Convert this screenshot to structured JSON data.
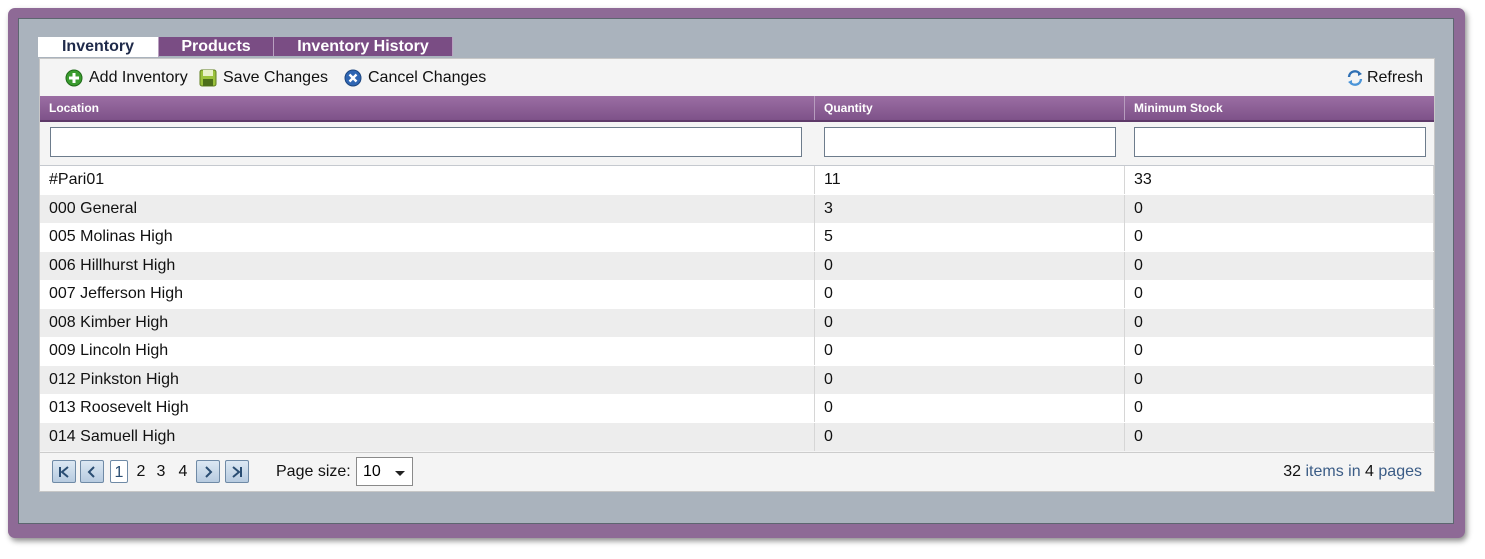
{
  "tabs": [
    {
      "label": "Inventory",
      "active": true
    },
    {
      "label": "Products",
      "active": false
    },
    {
      "label": "Inventory History",
      "active": false
    }
  ],
  "toolbar": {
    "add_label": "Add Inventory",
    "save_label": "Save Changes",
    "cancel_label": "Cancel Changes",
    "refresh_label": "Refresh"
  },
  "columns": [
    "Location",
    "Quantity",
    "Minimum Stock"
  ],
  "filters": {
    "location": "",
    "quantity": "",
    "minimum_stock": ""
  },
  "rows": [
    {
      "location": "#Pari01",
      "quantity": "11",
      "minimum_stock": "33"
    },
    {
      "location": "000 General",
      "quantity": "3",
      "minimum_stock": "0"
    },
    {
      "location": "005 Molinas High",
      "quantity": "5",
      "minimum_stock": "0"
    },
    {
      "location": "006 Hillhurst High",
      "quantity": "0",
      "minimum_stock": "0"
    },
    {
      "location": "007 Jefferson High",
      "quantity": "0",
      "minimum_stock": "0"
    },
    {
      "location": "008 Kimber High",
      "quantity": "0",
      "minimum_stock": "0"
    },
    {
      "location": "009 Lincoln High",
      "quantity": "0",
      "minimum_stock": "0"
    },
    {
      "location": "012 Pinkston High",
      "quantity": "0",
      "minimum_stock": "0"
    },
    {
      "location": "013 Roosevelt High",
      "quantity": "0",
      "minimum_stock": "0"
    },
    {
      "location": "014 Samuell High",
      "quantity": "0",
      "minimum_stock": "0"
    }
  ],
  "pager": {
    "pages": [
      "1",
      "2",
      "3",
      "4"
    ],
    "current_page": "1",
    "page_size_label": "Page size:",
    "page_size": "10",
    "total_items": "32",
    "items_in_text": "items in",
    "total_pages": "4",
    "pages_text": "pages"
  },
  "colors": {
    "frame": "#8e6a96",
    "header": "#7e5289",
    "panel": "#aab3bd",
    "link": "#3b5c86"
  }
}
